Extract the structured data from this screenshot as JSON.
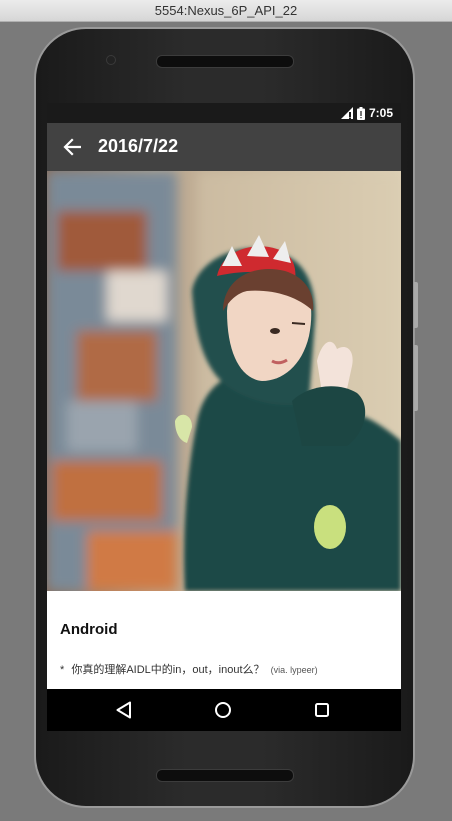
{
  "window": {
    "title": "5554:Nexus_6P_API_22"
  },
  "status_bar": {
    "time": "7:05",
    "icons": [
      "signal-icon",
      "battery-icon"
    ]
  },
  "app_bar": {
    "title": "2016/7/22",
    "back_icon": "arrow-back-icon"
  },
  "content": {
    "section_title": "Android",
    "items": [
      {
        "bullet": "*",
        "text": "你真的理解AIDL中的in，out，inout么？",
        "via": "(via. lypeer)"
      }
    ]
  },
  "nav_bar": {
    "buttons": [
      "back-triangle-icon",
      "home-circle-icon",
      "recents-square-icon"
    ]
  },
  "colors": {
    "app_bar": "#424242",
    "status_bar": "#1a1a1a",
    "nav_bar": "#000000",
    "emulator_bg": "#7a7a7a"
  }
}
